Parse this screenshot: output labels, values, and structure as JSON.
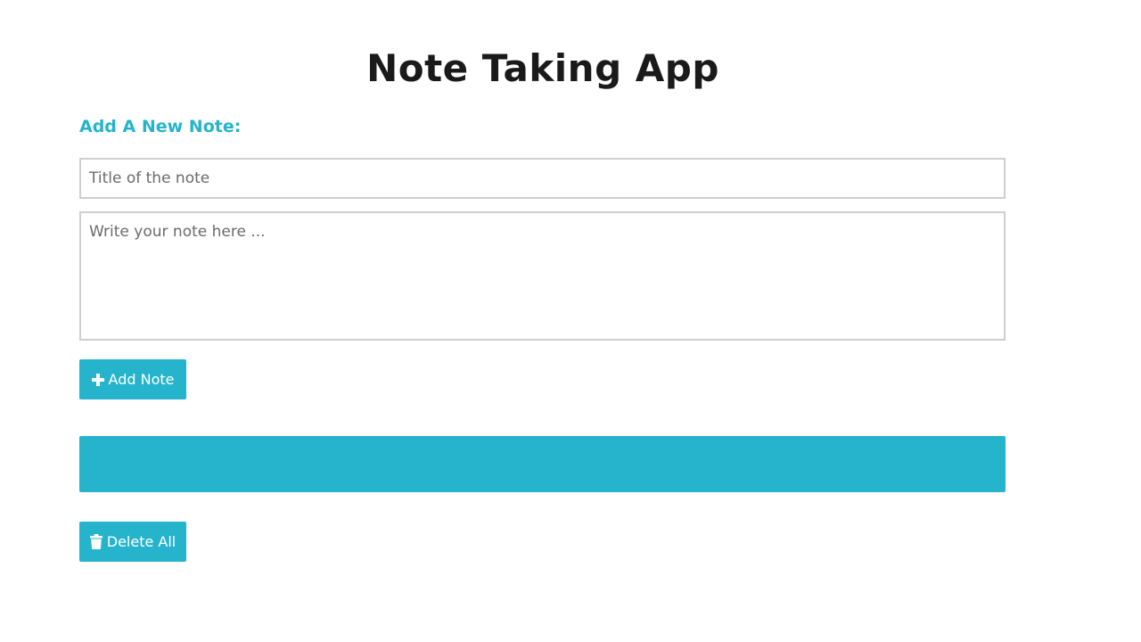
{
  "app": {
    "title": "Note Taking App"
  },
  "form": {
    "heading": "Add A New Note:",
    "title_placeholder": "Title of the note",
    "title_value": "",
    "body_placeholder": "Write your note here ...",
    "body_value": "",
    "add_button_label": "Add Note",
    "add_button_icon": "plus-icon"
  },
  "notes": {
    "items": []
  },
  "actions": {
    "delete_all_label": "Delete All",
    "delete_all_icon": "trash-icon"
  },
  "colors": {
    "accent": "#26b4cd",
    "title_text": "#1a1a1a",
    "input_border": "#cfcfcf",
    "button_text": "#ffffff"
  }
}
